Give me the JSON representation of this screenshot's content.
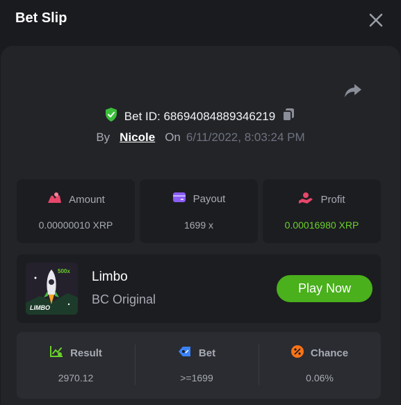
{
  "modal": {
    "title": "Bet Slip"
  },
  "bet": {
    "id_text": "Bet ID: 68694084889346219",
    "by_label": "By",
    "user": "Nicole",
    "on_label": "On",
    "date": "6/11/2022, 8:03:24 PM"
  },
  "stats": [
    {
      "label": "Amount",
      "value": "0.00000010 XRP",
      "icon": "coins-icon"
    },
    {
      "label": "Payout",
      "value": "1699 x",
      "icon": "card-icon"
    },
    {
      "label": "Profit",
      "value": "0.00016980 XRP",
      "icon": "hand-coin-icon"
    }
  ],
  "game": {
    "name": "Limbo",
    "provider": "BC Original",
    "play_label": "Play Now",
    "thumb_text": "LIMBO",
    "thumb_badge": "500x"
  },
  "results": [
    {
      "label": "Result",
      "value": "2970.12",
      "icon": "chart-check-icon"
    },
    {
      "label": "Bet",
      "value": ">=1699",
      "icon": "tag-icon"
    },
    {
      "label": "Chance",
      "value": "0.06%",
      "icon": "percent-icon"
    }
  ],
  "colors": {
    "background": "#1a1b1f",
    "panel": "#232428",
    "accent_green": "#4ab01c",
    "profit_green": "#6ad12a"
  }
}
